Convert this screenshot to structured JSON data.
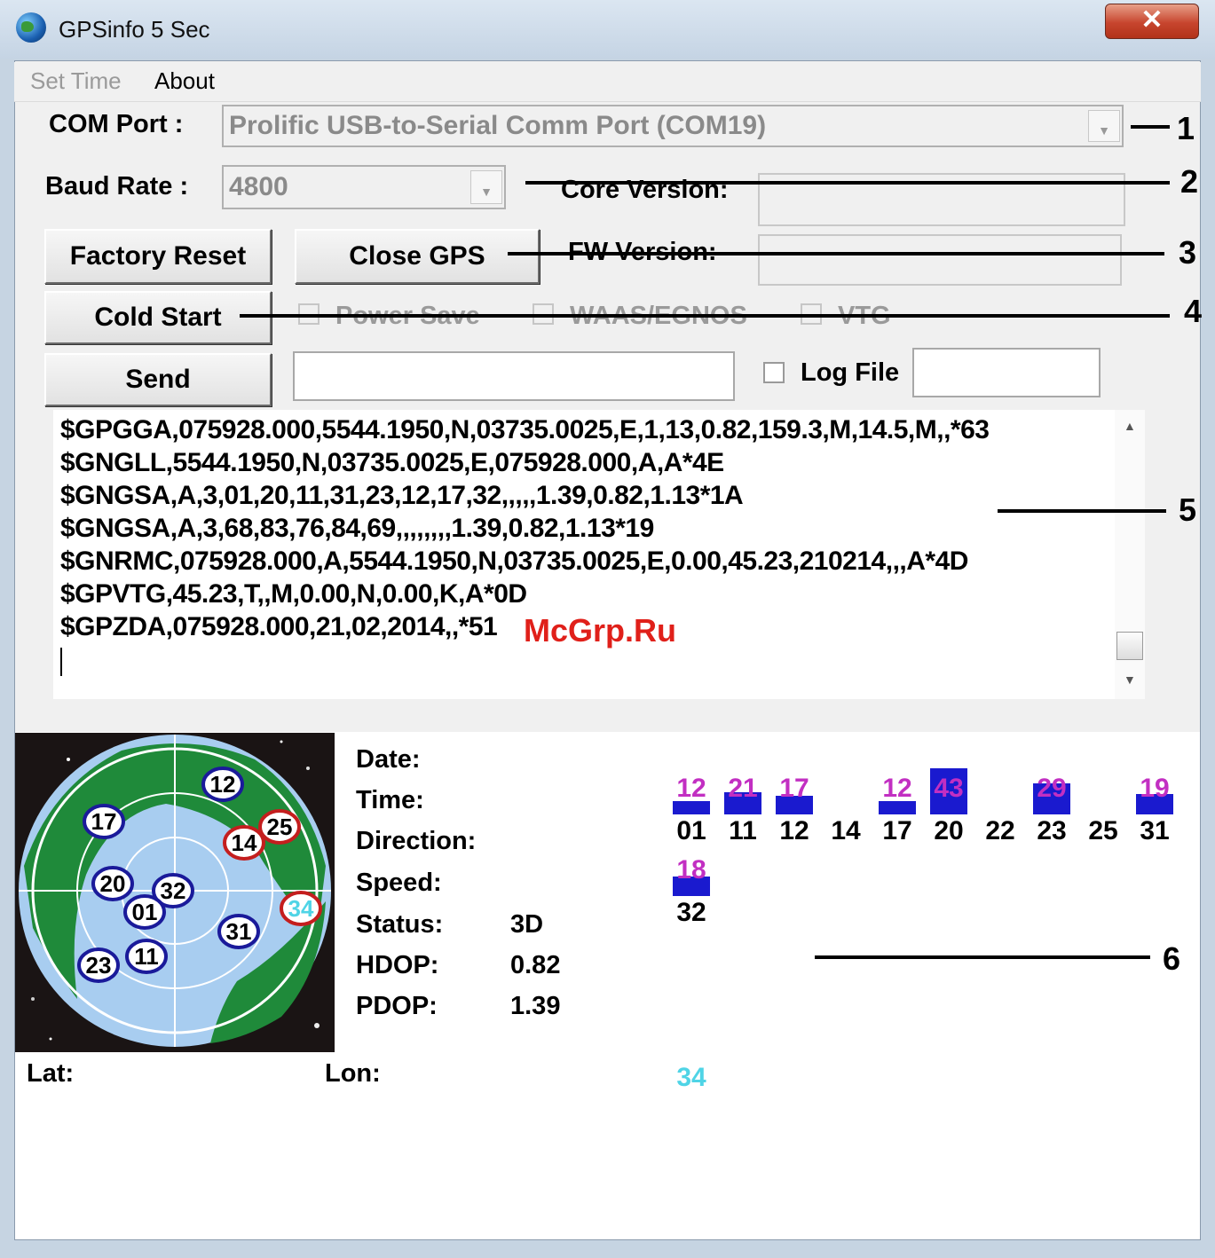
{
  "window": {
    "title": "GPSinfo  5 Sec",
    "close_glyph": "✕"
  },
  "menu": {
    "items": [
      "Set Time",
      "About"
    ]
  },
  "com_port": {
    "label": "COM Port :",
    "value": "Prolific USB-to-Serial Comm Port (COM19)"
  },
  "baud_rate": {
    "label": "Baud Rate :",
    "value": "4800"
  },
  "core_version": {
    "label": "Core Version:",
    "value": ""
  },
  "fw_version": {
    "label": "FW Version:",
    "value": ""
  },
  "buttons": {
    "factory_reset": "Factory Reset",
    "close_gps": "Close GPS",
    "cold_start": "Cold Start",
    "send": "Send"
  },
  "options": {
    "power_save": "Power Save",
    "waas": "WAAS/EGNOS",
    "vtg": "VTG",
    "log_file": "Log File"
  },
  "send_input": {
    "value": ""
  },
  "log_file_input": {
    "value": ""
  },
  "nmea_log": [
    "$GPGGA,075928.000,5544.1950,N,03735.0025,E,1,13,0.82,159.3,M,14.5,M,,*63",
    "$GNGLL,5544.1950,N,03735.0025,E,075928.000,A,A*4E",
    "$GNGSA,A,3,01,20,11,31,23,12,17,32,,,,,1.39,0.82,1.13*1A",
    "$GNGSA,A,3,68,83,76,84,69,,,,,,,,1.39,0.82,1.13*19",
    "$GNRMC,075928.000,A,5544.1950,N,03735.0025,E,0.00,45.23,210214,,,A*4D",
    "$GPVTG,45.23,T,,M,0.00,N,0.00,K,A*0D",
    "$GPZDA,075928.000,21,02,2014,,*51"
  ],
  "watermark": "McGrp.Ru",
  "info": {
    "date_label": "Date:",
    "date_value": "",
    "time_label": "Time:",
    "time_value": "",
    "direction_label": "Direction:",
    "direction_value": "",
    "speed_label": "Speed:",
    "speed_value": "",
    "status_label": "Status:",
    "status_value": "3D",
    "hdop_label": "HDOP:",
    "hdop_value": "0.82",
    "pdop_label": "PDOP:",
    "pdop_value": "1.39",
    "lat_label": "Lat:",
    "lat_value": "",
    "lon_label": "Lon:",
    "lon_value": ""
  },
  "sky_plot": {
    "satellites": [
      {
        "id": "12",
        "state": "used"
      },
      {
        "id": "17",
        "state": "used"
      },
      {
        "id": "14",
        "state": "not-used"
      },
      {
        "id": "25",
        "state": "not-used"
      },
      {
        "id": "20",
        "state": "used"
      },
      {
        "id": "32",
        "state": "used"
      },
      {
        "id": "01",
        "state": "used"
      },
      {
        "id": "34",
        "state": "sbas"
      },
      {
        "id": "31",
        "state": "used"
      },
      {
        "id": "23",
        "state": "used"
      },
      {
        "id": "11",
        "state": "used"
      }
    ]
  },
  "signal_bars": {
    "row1": [
      {
        "id": "01",
        "snr": "12",
        "level": 0.28
      },
      {
        "id": "11",
        "snr": "21",
        "level": 0.49
      },
      {
        "id": "12",
        "snr": "17",
        "level": 0.4
      },
      {
        "id": "14",
        "snr": "",
        "level": 0
      },
      {
        "id": "17",
        "snr": "12",
        "level": 0.28
      },
      {
        "id": "20",
        "snr": "43",
        "level": 1.0
      },
      {
        "id": "22",
        "snr": "",
        "level": 0
      },
      {
        "id": "23",
        "snr": "29",
        "level": 0.67
      },
      {
        "id": "25",
        "snr": "",
        "level": 0
      },
      {
        "id": "31",
        "snr": "19",
        "level": 0.44
      }
    ],
    "row2": [
      {
        "id": "32",
        "snr": "18",
        "level": 0.42
      }
    ],
    "sbas": {
      "id": "34",
      "color": "#4fd4e6"
    }
  },
  "callouts": [
    "1",
    "2",
    "3",
    "4",
    "5",
    "6"
  ],
  "colors": {
    "bar": "#1a1acf",
    "snr_text": "#c22fc2",
    "used_ring": "#1a1a9a",
    "unused_ring": "#c41e1e",
    "sbas_text": "#4fd4e6"
  }
}
